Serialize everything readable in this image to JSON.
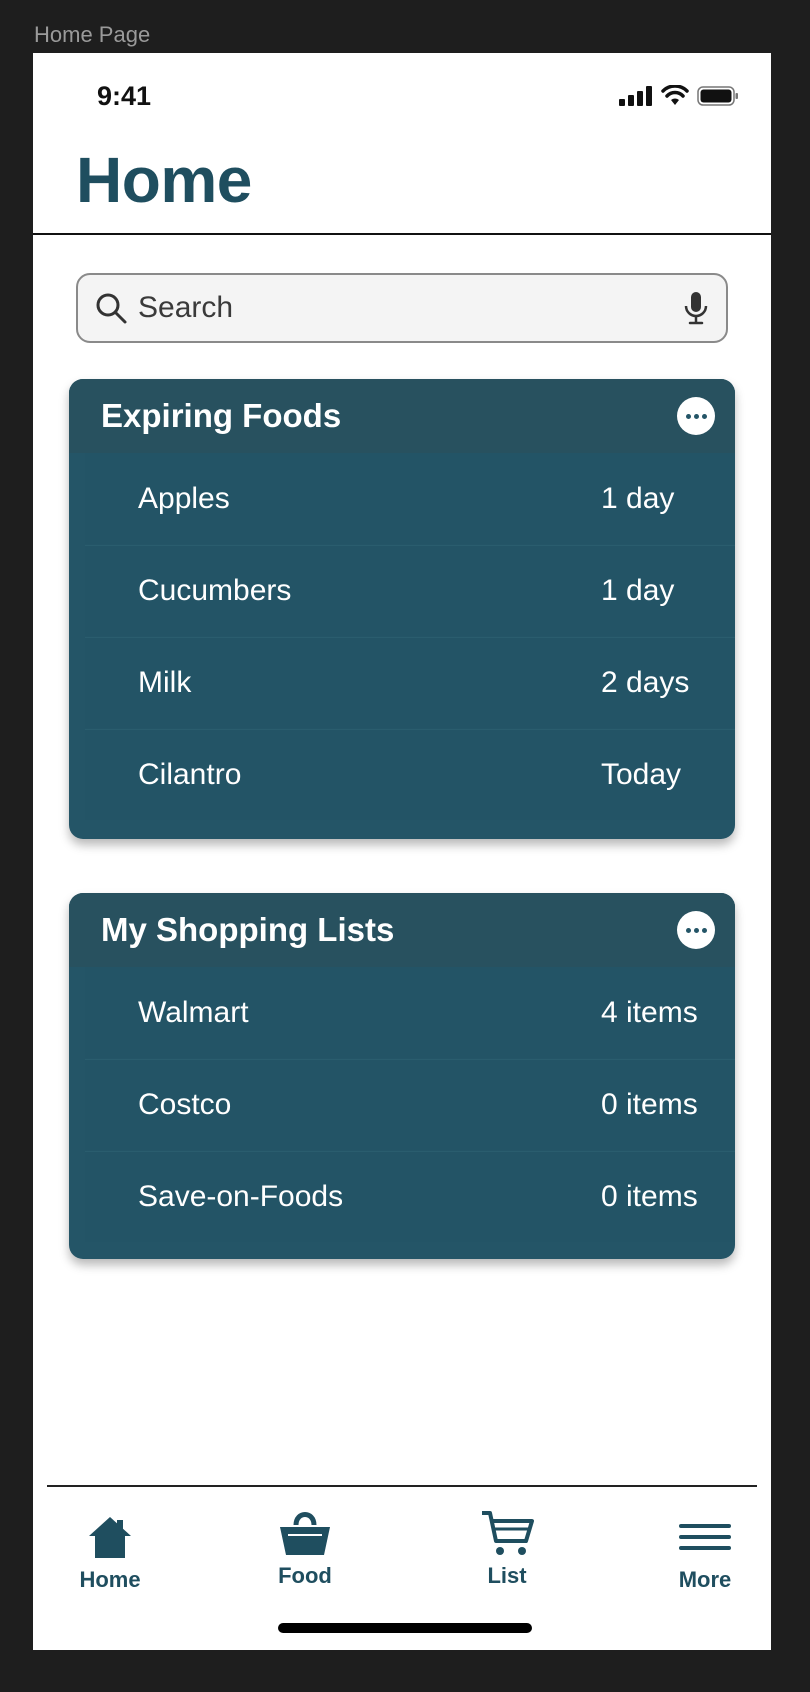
{
  "frame_label": "Home Page",
  "status_bar": {
    "time": "9:41"
  },
  "header": {
    "title": "Home"
  },
  "search": {
    "placeholder": "Search"
  },
  "expiring_foods": {
    "title": "Expiring Foods",
    "items": [
      {
        "name": "Apples",
        "value": "1 day"
      },
      {
        "name": "Cucumbers",
        "value": "1 day"
      },
      {
        "name": "Milk",
        "value": "2 days"
      },
      {
        "name": "Cilantro",
        "value": "Today"
      }
    ]
  },
  "shopping_lists": {
    "title": "My Shopping Lists",
    "items": [
      {
        "name": "Walmart",
        "value": "4 items"
      },
      {
        "name": "Costco",
        "value": "0 items"
      },
      {
        "name": "Save-on-Foods",
        "value": "0 items"
      }
    ]
  },
  "tab_bar": {
    "tabs": [
      {
        "label": "Home",
        "icon": "home-icon"
      },
      {
        "label": "Food",
        "icon": "basket-icon"
      },
      {
        "label": "List",
        "icon": "cart-icon"
      },
      {
        "label": "More",
        "icon": "menu-icon"
      }
    ]
  },
  "colors": {
    "accent": "#1f4e5f",
    "card_bg": "#245567",
    "card_header_bg": "#28515f"
  }
}
